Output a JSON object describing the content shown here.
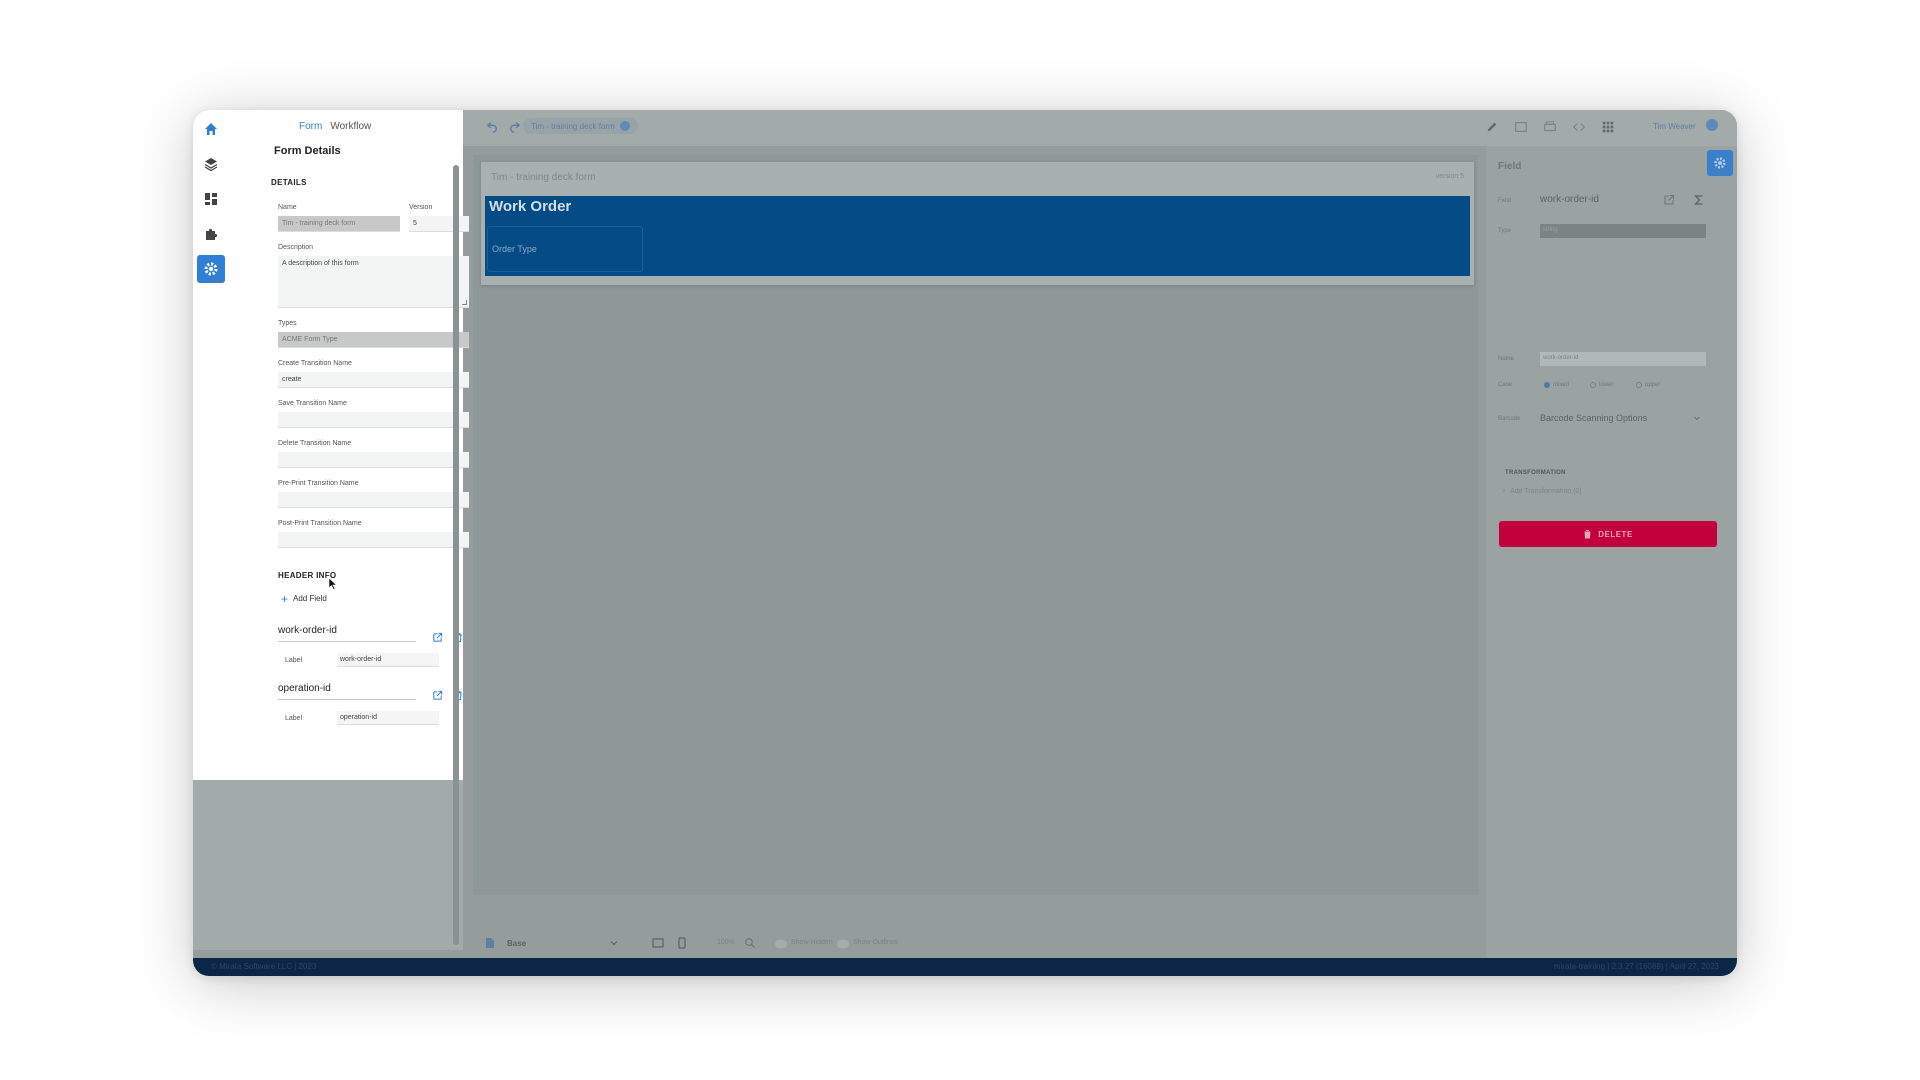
{
  "breadcrumb": {
    "form": "Form",
    "workflow": "Workflow"
  },
  "form_panel": {
    "title": "Form Details",
    "details_section": "DETAILS",
    "name_label": "Name",
    "name_value": "Tim - training deck form",
    "version_label": "Version",
    "version_value": "5",
    "description_label": "Description",
    "description_value": "A description of this form",
    "types_label": "Types",
    "types_value": "ACME Form Type",
    "create_transition_label": "Create Transition Name",
    "create_transition_value": "create",
    "save_transition_label": "Save Transition Name",
    "save_transition_value": "",
    "delete_transition_label": "Delete Transition Name",
    "delete_transition_value": "",
    "preprint_transition_label": "Pre-Print Transition Name",
    "preprint_transition_value": "",
    "postprint_transition_label": "Post-Print Transition Name",
    "postprint_transition_value": "",
    "header_info_section": "HEADER INFO",
    "add_field_label": "Add Field",
    "header_fields": [
      {
        "name": "work-order-id",
        "label_caption": "Label",
        "label_value": "work-order-id"
      },
      {
        "name": "operation-id",
        "label_caption": "Label",
        "label_value": "operation-id"
      }
    ]
  },
  "toolbar": {
    "form_chip": "Tim - training deck form",
    "user_name": "Tim Weaver"
  },
  "canvas": {
    "card_title": "Tim - training deck form",
    "card_version": "version 5",
    "section_title": "Work Order",
    "field_label": "Order Type"
  },
  "bottom_bar": {
    "view_name": "Base",
    "zoom": "100%",
    "show_hidden": "Show Hidden",
    "show_outlines": "Show Outlines"
  },
  "right_panel": {
    "title": "Field",
    "field_label": "Field",
    "field_value": "work-order-id",
    "type_label": "Type",
    "type_value": "string",
    "name_label": "Name",
    "name_value": "work-order-id",
    "case_label": "Case",
    "case_options": [
      "mixed",
      "lower",
      "upper"
    ],
    "case_selected": "mixed",
    "barcode_label": "Barcode",
    "barcode_value": "Barcode Scanning Options",
    "transformation_section": "TRANSFORMATION",
    "add_transformation": "Add Transformation (0)",
    "delete_label": "DELETE"
  },
  "footer": {
    "left": "© Mirata Software LLC | 2023",
    "right": "mirata-training | 2.3.27 (16089) | April 27, 2023"
  },
  "colors": {
    "accent": "#2f7fd6",
    "form_section_bg": "#054c86",
    "delete_button": "#c4003c",
    "footer_bg": "#0b2747"
  }
}
